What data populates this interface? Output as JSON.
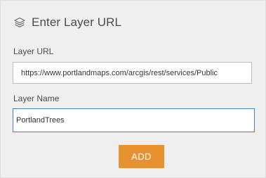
{
  "panel": {
    "title": "Enter Layer URL",
    "title_icon": "layers-icon"
  },
  "layer_url": {
    "label": "Layer URL",
    "value": "https://www.portlandmaps.com/arcgis/rest/services/Public"
  },
  "layer_name": {
    "label": "Layer Name",
    "value": "PortlandTrees"
  },
  "actions": {
    "add_label": "ADD"
  },
  "colors": {
    "panel_background": "#efefef",
    "accent_button": "#e8912f",
    "focus_border": "#4a7fb8"
  }
}
